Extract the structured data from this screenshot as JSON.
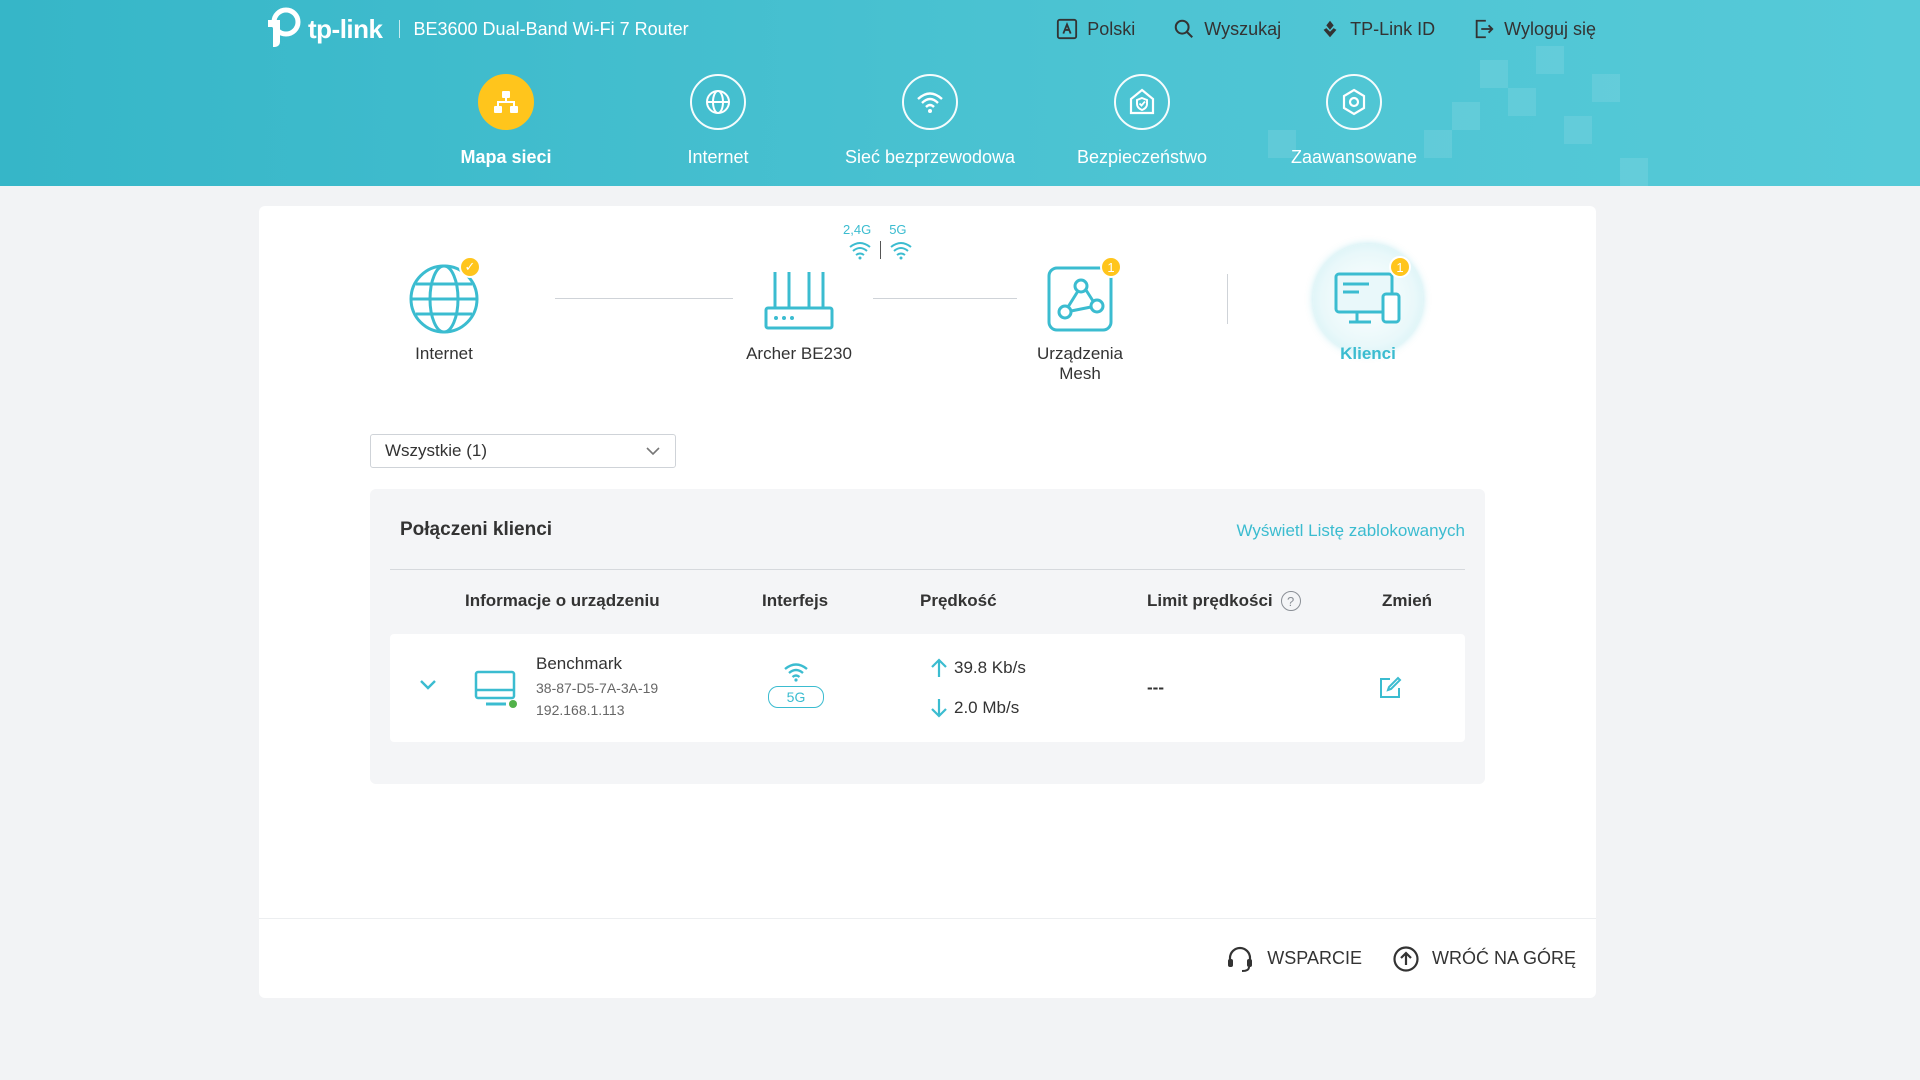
{
  "header": {
    "logo_text": "tp-link",
    "model": "BE3600 Dual-Band Wi-Fi 7 Router",
    "top_menu": [
      {
        "label": "Polski",
        "icon": "language-icon"
      },
      {
        "label": "Wyszukaj",
        "icon": "search-icon"
      },
      {
        "label": "TP-Link ID",
        "icon": "tplink-id-icon"
      },
      {
        "label": "Wyloguj się",
        "icon": "logout-icon"
      }
    ],
    "nav": [
      {
        "label": "Mapa sieci",
        "icon": "network-map-icon",
        "active": true
      },
      {
        "label": "Internet",
        "icon": "globe-icon",
        "active": false
      },
      {
        "label": "Sieć bezprzewodowa",
        "icon": "wifi-icon",
        "active": false
      },
      {
        "label": "Bezpieczeństwo",
        "icon": "shield-icon",
        "active": false
      },
      {
        "label": "Zaawansowane",
        "icon": "gear-icon",
        "active": false
      }
    ]
  },
  "topology": {
    "internet": {
      "label": "Internet",
      "status": "connected"
    },
    "router": {
      "label": "Archer BE230",
      "band_24": "2,4G",
      "band_5": "5G"
    },
    "mesh": {
      "label_line1": "Urządzenia",
      "label_line2": "Mesh",
      "count": "1"
    },
    "clients": {
      "label": "Klienci",
      "count": "1"
    }
  },
  "filter": {
    "selected": "Wszystkie (1)"
  },
  "clients_panel": {
    "title": "Połączeni klienci",
    "blocked_link": "Wyświetl Listę zablokowanych",
    "columns": {
      "device": "Informacje o urządzeniu",
      "interface": "Interfejs",
      "speed": "Prędkość",
      "limit": "Limit prędkości",
      "edit": "Zmień"
    },
    "rows": [
      {
        "name": "Benchmark",
        "mac": "38-87-D5-7A-3A-19",
        "ip": "192.168.1.113",
        "band": "5G",
        "upload": "39.8 Kb/s",
        "download": "2.0 Mb/s",
        "limit": "---"
      }
    ]
  },
  "footer": {
    "support": "WSPARCIE",
    "back_to_top": "WRÓĆ NA GÓRĘ"
  },
  "colors": {
    "header": "#3fbccd",
    "accent": "#3bbcd0",
    "active_nav": "#ffc51c"
  }
}
